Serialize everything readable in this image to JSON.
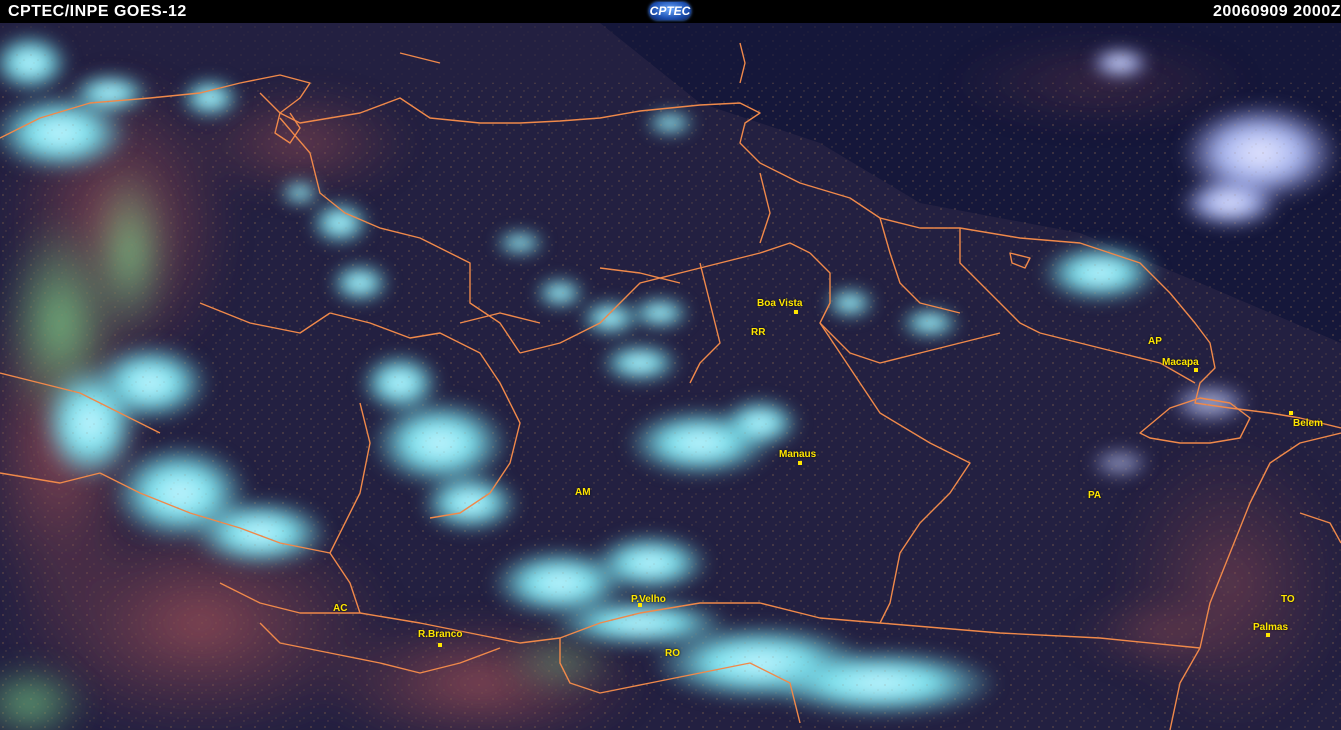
{
  "header": {
    "left_text": "CPTEC/INPE GOES-12",
    "logo_text": "CPTEC",
    "right_text": "20060909 2000Z"
  },
  "colors": {
    "border_lines": "#f0894a",
    "labels": "#ffe600",
    "background_dark": "#1a1b3f",
    "cloud_cyan": "#79e6f0",
    "land_red": "#7d3f4a"
  },
  "map": {
    "cities": [
      {
        "name": "Boa Vista"
      },
      {
        "name": "Macapa"
      },
      {
        "name": "Belem"
      },
      {
        "name": "Manaus"
      },
      {
        "name": "P.Velho"
      },
      {
        "name": "R.Branco"
      },
      {
        "name": "Palmas"
      }
    ],
    "states": [
      {
        "code": "RR"
      },
      {
        "code": "AP"
      },
      {
        "code": "AM"
      },
      {
        "code": "PA"
      },
      {
        "code": "AC"
      },
      {
        "code": "RO"
      },
      {
        "code": "TO"
      }
    ]
  }
}
